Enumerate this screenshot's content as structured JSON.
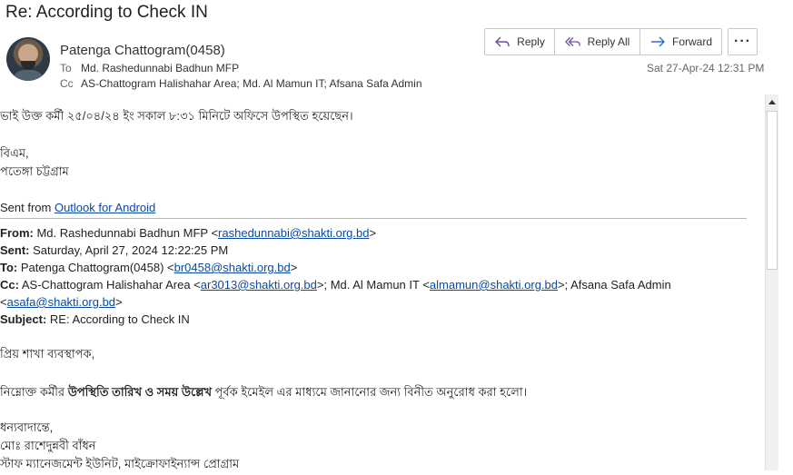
{
  "email": {
    "subject": "Re: According to Check IN",
    "from_name": "Patenga Chattogram(0458)",
    "to_label": "To",
    "to_value": "Md. Rashedunnabi Badhun MFP",
    "cc_label": "Cc",
    "cc_value": "AS-Chattogram Halishahar Area; Md. Al Mamun IT; Afsana Safa Admin",
    "date": "Sat 27-Apr-24 12:31 PM"
  },
  "actions": {
    "reply": "Reply",
    "reply_all": "Reply All",
    "forward": "Forward",
    "more": "···"
  },
  "body": {
    "line1": "ভাই উক্ত কর্মী ২৫/০৪/২৪ ইং সকাল ৮:৩১ মিনিটে অফিসে উপস্থিত হয়েছেন।",
    "line2": "বিএম,",
    "line3": "পতেঙ্গা চট্টগ্রাম",
    "sent_from_prefix": "Sent from ",
    "sent_from_link": "Outlook for Android"
  },
  "quoted": {
    "from_label": "From:",
    "from_name": " Md. Rashedunnabi Badhun MFP <",
    "from_email": "rashedunnabi@shakti.org.bd",
    "sent_label": "Sent:",
    "sent_value": " Saturday, April 27, 2024 12:22:25 PM",
    "to_label": "To:",
    "to_name": " Patenga Chattogram(0458) <",
    "to_email": "br0458@shakti.org.bd",
    "cc_label": "Cc:",
    "cc_name1": " AS-Chattogram Halishahar Area <",
    "cc_email1": "ar3013@shakti.org.bd",
    "cc_name2": ">; Md. Al Mamun IT <",
    "cc_email2": "almamun@shakti.org.bd",
    "cc_name3": ">; Afsana Safa Admin",
    "cc_email3": "asafa@shakti.org.bd",
    "subject_label": "Subject:",
    "subject_value": " RE: According to Check IN",
    "greeting": "প্রিয় শাখা ব্যবস্থাপক,",
    "req_pre": "নিম্নোক্ত কর্মীর ",
    "req_bold": "উপস্থিতি তারিখ ও সময় উল্লেখ",
    "req_post": " পূর্বক ইমেইল এর মাধ্যমে জানানোর জন্য বিনীত অনুরোধ করা হলো।",
    "thanks": "ধন্যবাদান্তে,",
    "sig_name": "মোঃ রাশেদুন্নবী বাঁধন",
    "sig_unit": "স্টাফ ম্যানেজমেন্ট ইউনিট, মাইক্রোফাইন্যান্স প্রোগ্রাম"
  }
}
